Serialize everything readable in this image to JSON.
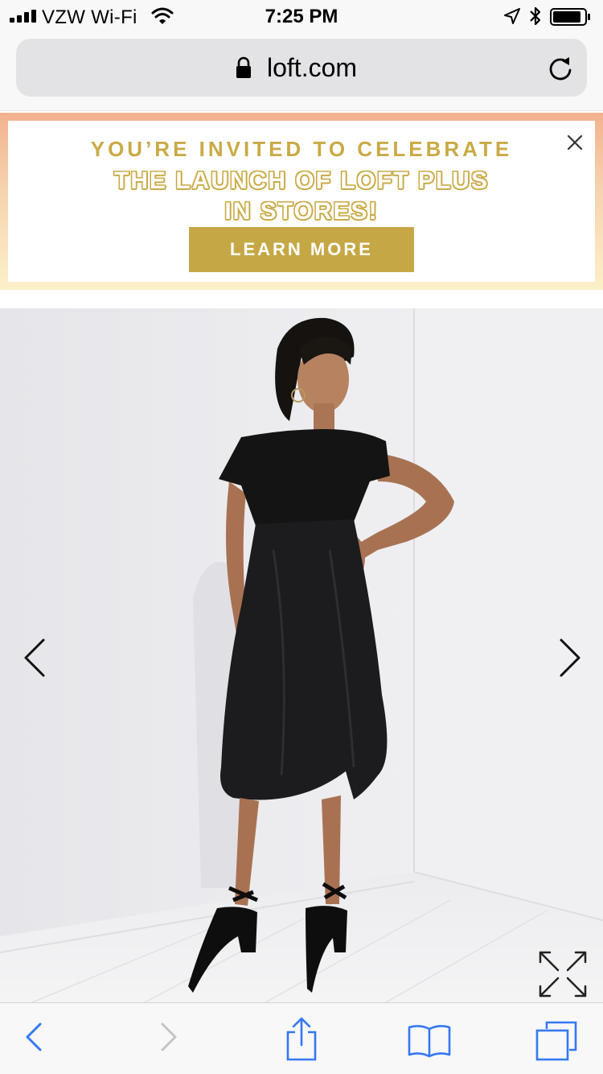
{
  "status_bar": {
    "carrier": "VZW Wi-Fi",
    "time": "7:25 PM"
  },
  "browser": {
    "url": "loft.com"
  },
  "promo": {
    "line1": "YOU’RE INVITED TO CELEBRATE",
    "line2": "THE LAUNCH OF LOFT PLUS",
    "line3": "IN STORES!",
    "button_label": "LEARN MORE",
    "accent_color": "#c5a845"
  },
  "icons": {
    "status": [
      "signal-icon",
      "wifi-icon",
      "location-icon",
      "bluetooth-icon",
      "battery-icon"
    ],
    "url_bar": [
      "lock-icon",
      "reload-icon"
    ],
    "promo": [
      "close-icon"
    ],
    "gallery": [
      "chevron-left-icon",
      "chevron-right-icon",
      "expand-icon"
    ],
    "toolbar": [
      "back-icon",
      "forward-icon",
      "share-icon",
      "bookmarks-icon",
      "tabs-icon"
    ]
  },
  "colors": {
    "toolbar_tint": "#3478f6",
    "disabled": "#c4c4c6"
  }
}
